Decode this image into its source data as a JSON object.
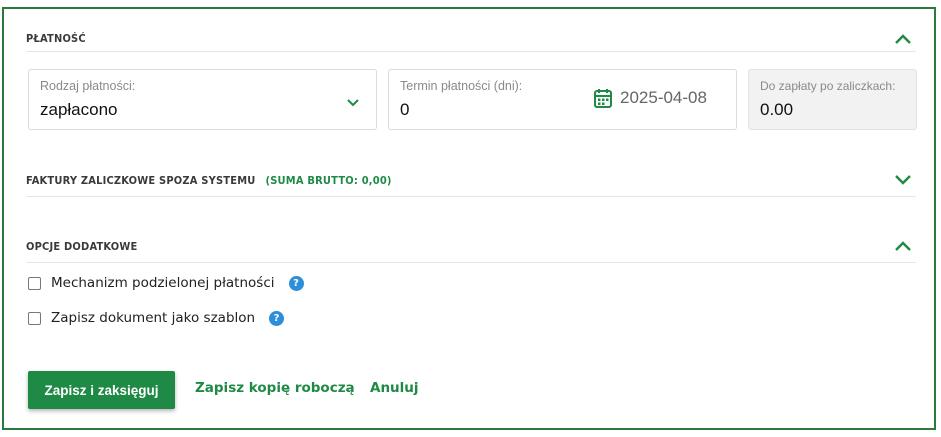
{
  "payment": {
    "title": "PŁATNOŚĆ",
    "method_label": "Rodzaj płatności:",
    "method_value": "zapłacono",
    "term_label": "Termin płatności (dni):",
    "term_value": "0",
    "due_date": "2025-04-08",
    "to_pay_label": "Do zapłaty po zaliczkach:",
    "to_pay_value": "0.00"
  },
  "advance_invoices": {
    "title": "FAKTURY ZALICZKOWE SPOZA SYSTEMU",
    "sum": "(SUMA BRUTTO: 0,00)"
  },
  "extra_options": {
    "title": "OPCJE DODATKOWE",
    "split_payment_label": "Mechanizm podzielonej płatności",
    "save_template_label": "Zapisz dokument jako szablon",
    "help_glyph": "?"
  },
  "actions": {
    "save_post": "Zapisz i zaksięguj",
    "save_draft": "Zapisz kopię roboczą",
    "cancel": "Anuluj"
  },
  "colors": {
    "accent": "#1f8a45",
    "frame": "#2b7a3b",
    "help": "#2d8fd9"
  }
}
